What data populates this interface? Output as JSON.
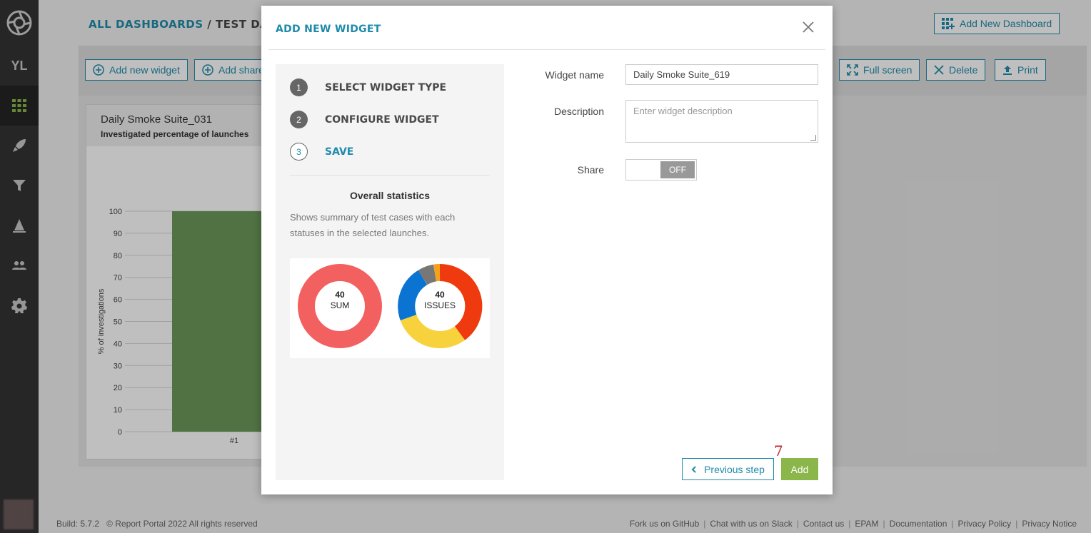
{
  "sidebar": {
    "project_initials": "YL",
    "items": [
      {
        "icon": "dashboard-icon",
        "active": true
      },
      {
        "icon": "rocket-icon"
      },
      {
        "icon": "filter-icon"
      },
      {
        "icon": "debug-icon"
      },
      {
        "icon": "members-icon"
      },
      {
        "icon": "gear-icon"
      }
    ]
  },
  "header": {
    "breadcrumb_link": "ALL DASHBOARDS",
    "breadcrumb_sep": " / ",
    "breadcrumb_current": "TEST DASHBOAR",
    "add_dashboard": "Add New Dashboard"
  },
  "toolbar": {
    "add_widget": "Add new widget",
    "add_shared": "Add share",
    "full_screen": "Full screen",
    "delete": "Delete",
    "print": "Print"
  },
  "widget": {
    "title": "Daily Smoke Suite_031",
    "subtitle": "Investigated percentage of launches",
    "chart_data": {
      "type": "bar",
      "categories": [
        "#1"
      ],
      "values": [
        100
      ],
      "ylabel": "% of investigations",
      "ylim": [
        0,
        100
      ],
      "yticks": [
        "100",
        "90",
        "80",
        "70",
        "60",
        "50",
        "40",
        "30",
        "20",
        "10",
        "0"
      ],
      "bar_color": "#6c9a5a"
    }
  },
  "modal": {
    "title": "ADD NEW WIDGET",
    "steps": [
      {
        "num": "1",
        "label": "SELECT WIDGET TYPE",
        "state": "done"
      },
      {
        "num": "2",
        "label": "CONFIGURE WIDGET",
        "state": "done"
      },
      {
        "num": "3",
        "label": "SAVE",
        "state": "current"
      }
    ],
    "stats_title": "Overall statistics",
    "stats_desc": "Shows summary of test cases with each statuses in the selected launches.",
    "preview": {
      "sum_value": "40",
      "sum_label": "SUM",
      "issues_value": "40",
      "issues_label": "ISSUES"
    },
    "form": {
      "name_label": "Widget name",
      "name_value": "Daily Smoke Suite_619",
      "description_label": "Description",
      "description_placeholder": "Enter widget description",
      "share_label": "Share",
      "share_state": "OFF"
    },
    "prev_step": "Previous step",
    "add": "Add",
    "marker": "7"
  },
  "footer": {
    "build": "Build: 5.7.2",
    "copyright": "© Report Portal 2022 All rights reserved",
    "links": [
      "Fork us on GitHub",
      "Chat with us on Slack",
      "Contact us",
      "EPAM",
      "Documentation",
      "Privacy Policy",
      "Privacy Notice"
    ]
  },
  "colors": {
    "accent": "#1f8bab",
    "success": "#8ab64a",
    "sidebar": "#333333"
  }
}
